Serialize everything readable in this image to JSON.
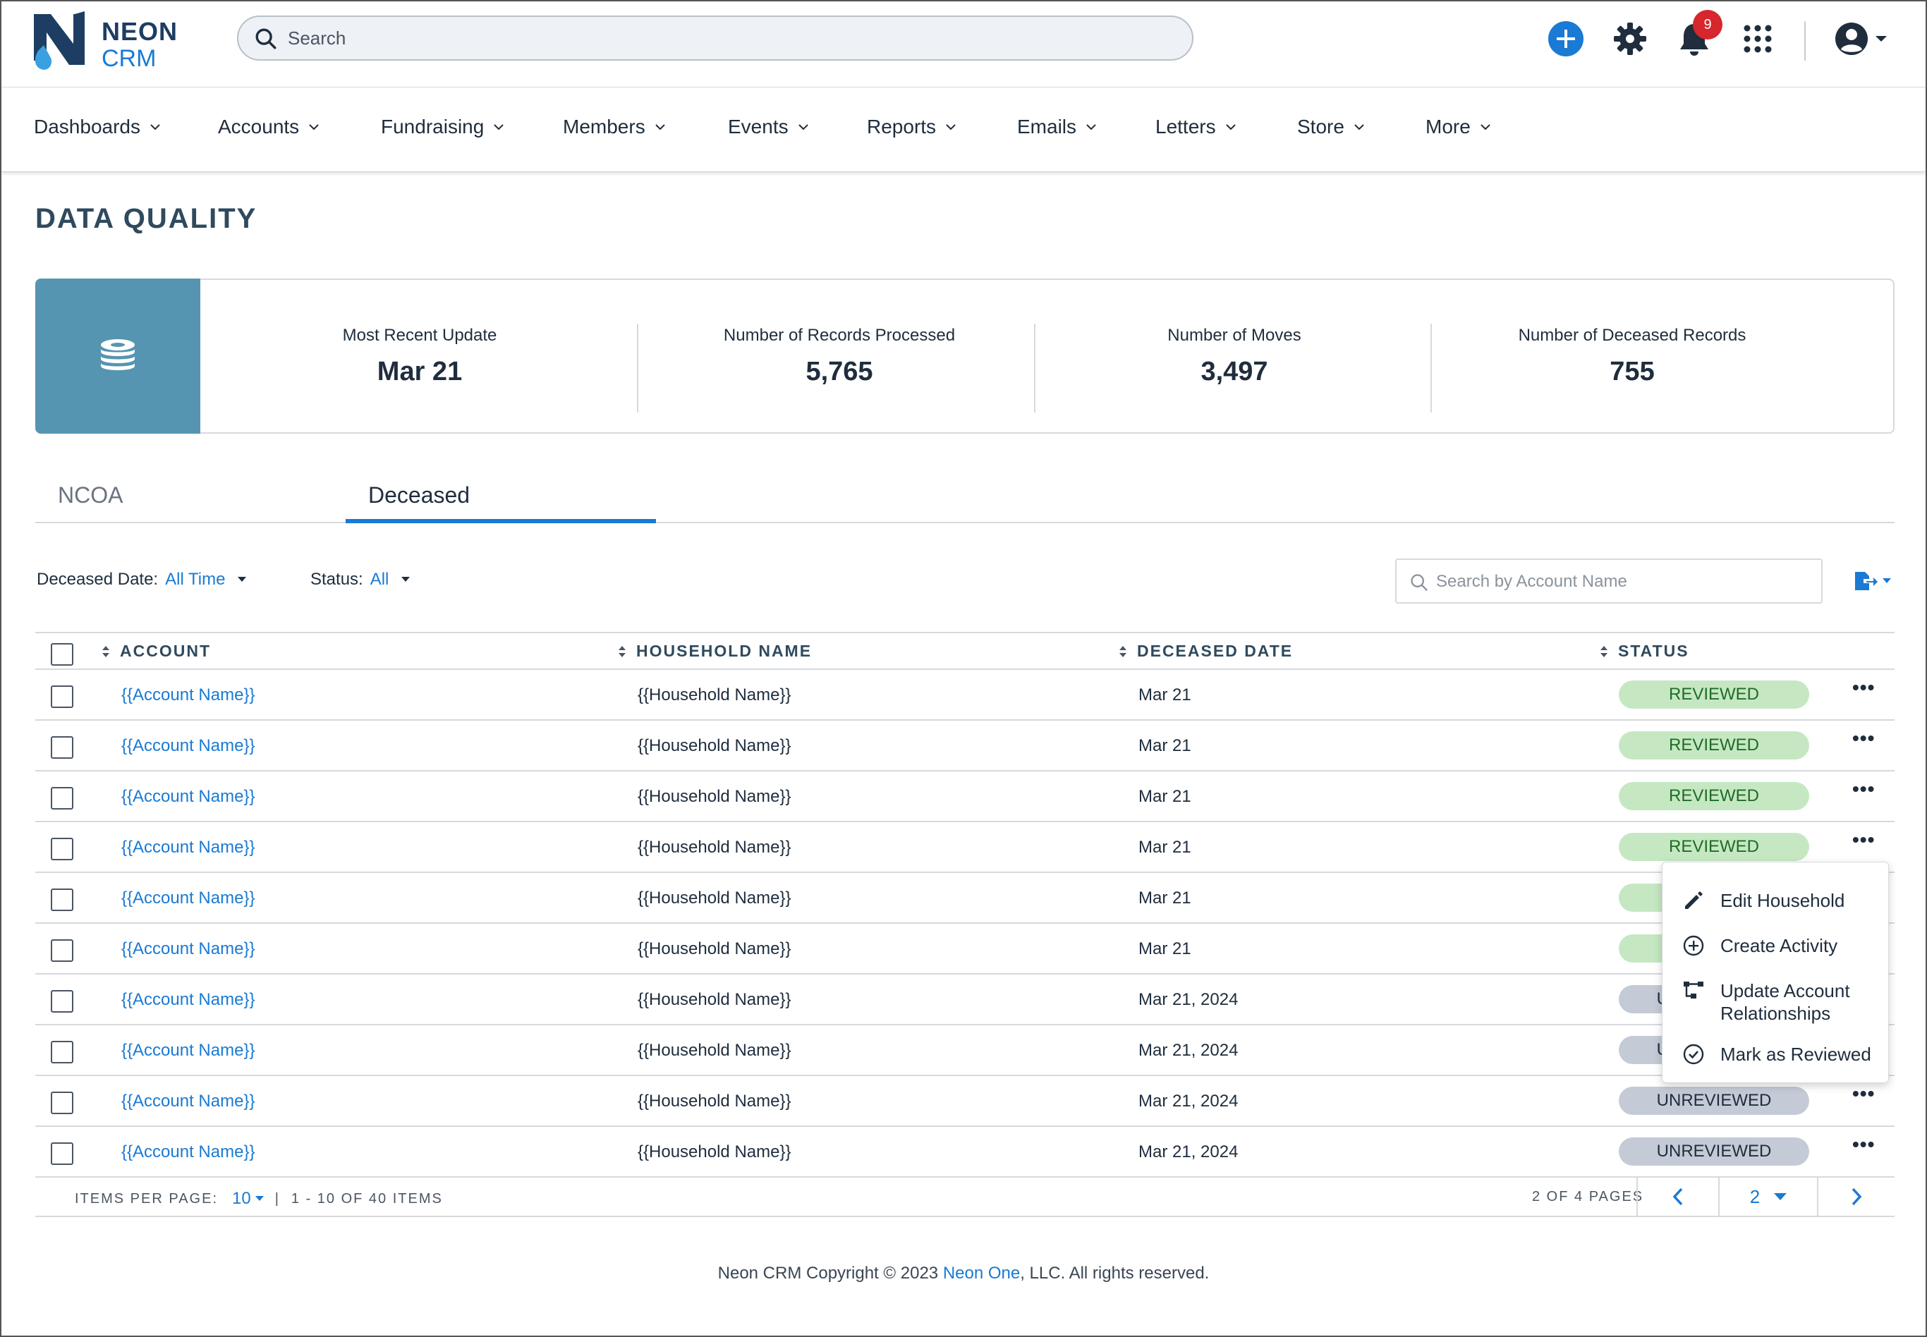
{
  "app": {
    "logo_neon": "NEON",
    "logo_crm": "CRM",
    "search_placeholder": "Search",
    "notification_count": "9"
  },
  "nav": {
    "items": [
      {
        "label": "Dashboards"
      },
      {
        "label": "Accounts"
      },
      {
        "label": "Fundraising"
      },
      {
        "label": "Members"
      },
      {
        "label": "Events"
      },
      {
        "label": "Reports"
      },
      {
        "label": "Emails"
      },
      {
        "label": "Letters"
      },
      {
        "label": "Store"
      },
      {
        "label": "More"
      }
    ]
  },
  "page": {
    "title": "DATA QUALITY"
  },
  "stats": [
    {
      "label": "Most Recent Update",
      "value": "Mar 21"
    },
    {
      "label": "Number of Records Processed",
      "value": "5,765"
    },
    {
      "label": "Number of Moves",
      "value": "3,497"
    },
    {
      "label": "Number of Deceased Records",
      "value": "755"
    }
  ],
  "tabs": [
    {
      "label": "NCOA",
      "active": false
    },
    {
      "label": "Deceased",
      "active": true
    }
  ],
  "filters": {
    "deceased_date_label": "Deceased Date:",
    "deceased_date_value": "All Time",
    "status_label": "Status:",
    "status_value": "All",
    "account_search_placeholder": "Search by Account Name"
  },
  "table": {
    "headers": {
      "account": "ACCOUNT",
      "household": "HOUSEHOLD NAME",
      "deceased_date": "DECEASED DATE",
      "status": "STATUS"
    },
    "rows": [
      {
        "account": "{{Account Name}}",
        "household": "{{Household Name}}",
        "date": "Mar 21",
        "status": "REVIEWED"
      },
      {
        "account": "{{Account Name}}",
        "household": "{{Household Name}}",
        "date": "Mar 21",
        "status": "REVIEWED"
      },
      {
        "account": "{{Account Name}}",
        "household": "{{Household Name}}",
        "date": "Mar 21",
        "status": "REVIEWED"
      },
      {
        "account": "{{Account Name}}",
        "household": "{{Household Name}}",
        "date": "Mar 21",
        "status": "REVIEWED"
      },
      {
        "account": "{{Account Name}}",
        "household": "{{Household Name}}",
        "date": "Mar 21",
        "status": "REVIEWED"
      },
      {
        "account": "{{Account Name}}",
        "household": "{{Household Name}}",
        "date": "Mar 21",
        "status": "REVIEWED"
      },
      {
        "account": "{{Account Name}}",
        "household": "{{Household Name}}",
        "date": "Mar 21, 2024",
        "status": "UNREVIEWED"
      },
      {
        "account": "{{Account Name}}",
        "household": "{{Household Name}}",
        "date": "Mar 21, 2024",
        "status": "UNREVIEWED"
      },
      {
        "account": "{{Account Name}}",
        "household": "{{Household Name}}",
        "date": "Mar 21, 2024",
        "status": "UNREVIEWED"
      },
      {
        "account": "{{Account Name}}",
        "household": "{{Household Name}}",
        "date": "Mar 21, 2024",
        "status": "UNREVIEWED"
      }
    ]
  },
  "pagination": {
    "items_per_page_label": "ITEMS PER PAGE:",
    "items_per_page_value": "10",
    "range": "1 - 10 OF 40 ITEMS",
    "pages_label": "2 OF 4 PAGES",
    "current_page": "2"
  },
  "context_menu": {
    "items": [
      {
        "label": "Edit Household",
        "icon": "pencil-icon"
      },
      {
        "label": "Create Activity",
        "icon": "plus-circle-icon"
      },
      {
        "label": "Update Account Relationships",
        "icon": "hierarchy-icon"
      },
      {
        "label": "Mark as Reviewed",
        "icon": "check-circle-icon"
      }
    ]
  },
  "footer": {
    "prefix": "Neon CRM Copyright © 2023 ",
    "link": "Neon One",
    "suffix": ", LLC. All rights reserved."
  },
  "colors": {
    "accent": "#1a7ad4",
    "brand_dark": "#1d3d63",
    "stats_tile": "#5695b1",
    "reviewed_bg": "#c5e8c2",
    "unreviewed_bg": "#c4cad6",
    "badge": "#d7262d"
  }
}
